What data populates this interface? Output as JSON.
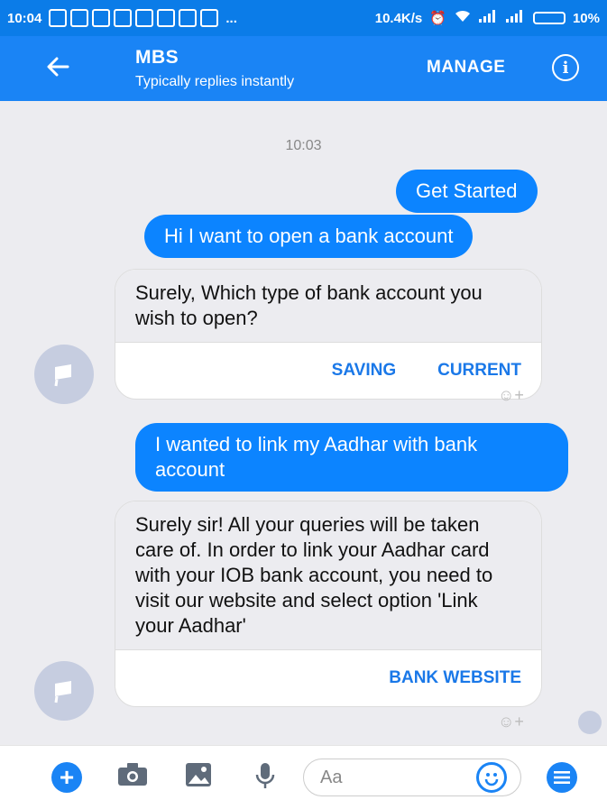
{
  "status_bar": {
    "time": "10:04",
    "overflow": "...",
    "speed": "10.4K/s",
    "battery": "10%",
    "colors": {
      "background": "#0b7ce8"
    }
  },
  "header": {
    "title": "MBS",
    "subtitle": "Typically replies instantly",
    "manage_label": "MANAGE",
    "info_label": "i",
    "back_icon": "arrow-left-icon",
    "colors": {
      "background": "#1a84f5"
    }
  },
  "chat": {
    "timestamp": "10:03",
    "outgoing": [
      {
        "text": "Get Started"
      },
      {
        "text": "Hi I want to open a bank account"
      },
      {
        "text": "I wanted to link my Aadhar with bank account"
      }
    ],
    "cards": [
      {
        "text": "Surely, Which type of bank account you wish to open?",
        "buttons": [
          "SAVING",
          "CURRENT"
        ]
      },
      {
        "text": "Surely sir! All your queries will be taken care of. In order to link your Aadhar card with your IOB bank account, you need to visit our website and select option 'Link your Aadhar'",
        "buttons": [
          "BANK WEBSITE"
        ]
      }
    ],
    "reaction_label": "☺+",
    "colors": {
      "outgoing": "#0c84ff",
      "button_text": "#1a78e8"
    }
  },
  "composer": {
    "placeholder": "Aa",
    "icons": [
      "plus-icon",
      "camera-icon",
      "gallery-icon",
      "microphone-icon",
      "emoji-icon",
      "menu-icon"
    ]
  }
}
